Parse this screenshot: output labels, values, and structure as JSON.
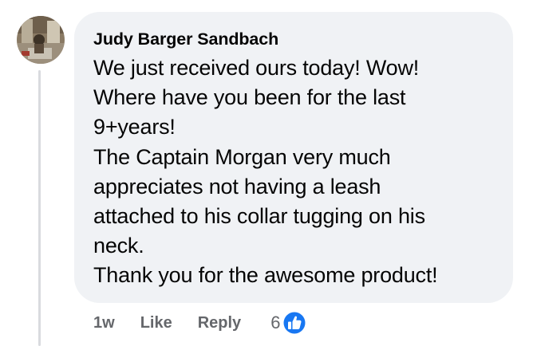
{
  "comment": {
    "author": "Judy Barger Sandbach",
    "lines": [
      "We just received ours today! Wow!",
      "Where have you been for the last",
      "9+years!",
      "The Captain Morgan very much",
      "appreciates not having a leash",
      "attached to his collar tugging on his",
      "neck.",
      "Thank you for the awesome product!"
    ]
  },
  "actions": {
    "timestamp": "1w",
    "like_label": "Like",
    "reply_label": "Reply",
    "reaction_count": "6"
  },
  "icons": {
    "reaction": "thumbs-up-icon"
  },
  "colors": {
    "bubble_background": "#f0f2f5",
    "text_primary": "#050505",
    "text_secondary": "#65676b",
    "like_blue": "#1877f2",
    "thread_line": "#d9dbdf"
  }
}
